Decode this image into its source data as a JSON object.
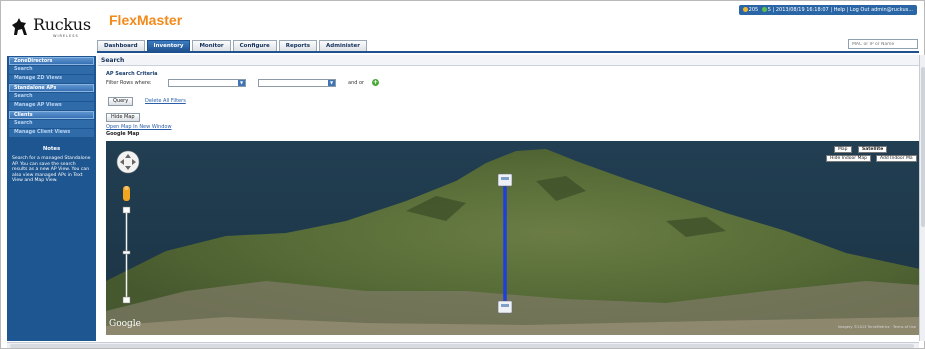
{
  "header": {
    "logo_text": "Ruckus",
    "logo_sub": "WIRELESS",
    "product": "FlexMaster",
    "user_bar": {
      "alarm_count_1": "205",
      "alarm_count_2": "5",
      "datetime": "2013/08/19 16:18:07",
      "help": "Help",
      "logout": "Log Out",
      "user": "admin@ruckus..."
    }
  },
  "tabs": [
    {
      "label": "Dashboard"
    },
    {
      "label": "Inventory"
    },
    {
      "label": "Monitor"
    },
    {
      "label": "Configure"
    },
    {
      "label": "Reports"
    },
    {
      "label": "Administer"
    }
  ],
  "active_tab": "Inventory",
  "search": {
    "placeholder": "MAC or IP or Name"
  },
  "sidebar": {
    "items": [
      {
        "label": "ZoneDirectors",
        "type": "header"
      },
      {
        "label": "Search",
        "type": "link"
      },
      {
        "label": "Manage ZD Views",
        "type": "link"
      },
      {
        "label": "Standalone APs",
        "type": "header"
      },
      {
        "label": "Search",
        "type": "link"
      },
      {
        "label": "Manage AP Views",
        "type": "link"
      },
      {
        "label": "Clients",
        "type": "header"
      },
      {
        "label": "Search",
        "type": "link"
      },
      {
        "label": "Manage Client Views",
        "type": "link"
      }
    ],
    "notes_title": "Notes",
    "notes_text": "Search for a managed Standalone AP. You can save the search results as a new AP View. You can also view managed APs in Text View and Map View."
  },
  "main": {
    "section_title": "Search",
    "criteria_title": "AP Search Criteria",
    "filter_label": "Filter Rows where:",
    "and_or": "and or",
    "query_button": "Query",
    "delete_filters": "Delete All Filters",
    "hide_map_button": "Hide Map",
    "open_map_link": "Open Map In New Window",
    "map_label": "Google Map"
  },
  "map": {
    "btn_map": "Map",
    "btn_satellite": "Satellite",
    "btn_hide_indoor": "Hide Indoor Map",
    "btn_add_indoor": "Add Indoor Ma",
    "google": "Google",
    "copyright": "Imagery ©2013 TerraMetrics · Terms of Use",
    "colors": {
      "link_line": "#1f3fd6",
      "land": "#5a6f3c",
      "sea": "#1c3647"
    }
  }
}
